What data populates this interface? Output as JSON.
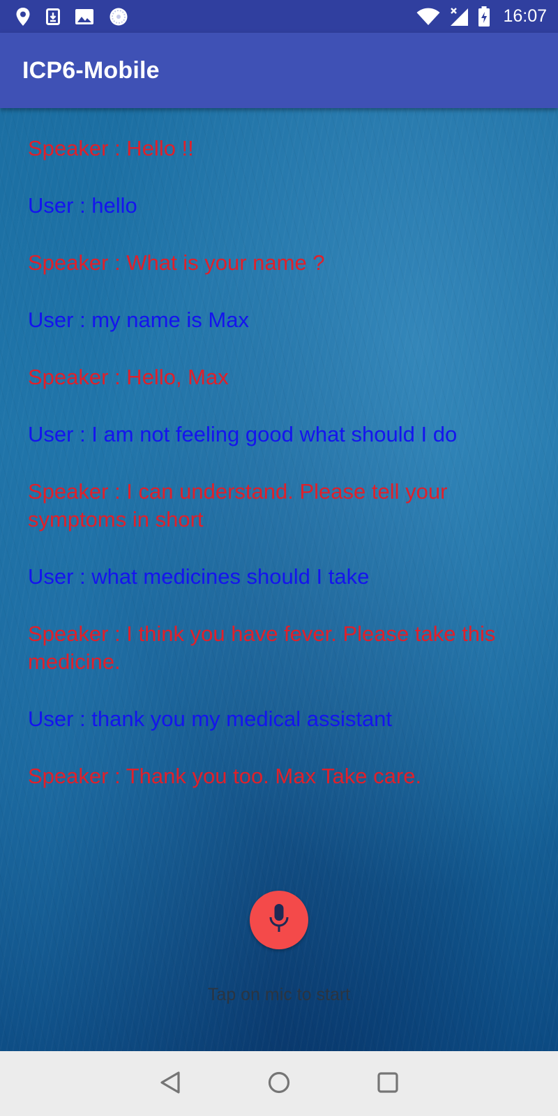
{
  "status_bar": {
    "time": "16:07",
    "icons": [
      "location-icon",
      "download-icon",
      "image-icon",
      "sync-icon",
      "wifi-icon",
      "signal-icon",
      "battery-charging-icon"
    ]
  },
  "app_bar": {
    "title": "ICP6-Mobile",
    "color": "#3f51b5"
  },
  "conversation": [
    {
      "role": "speaker",
      "text": "Speaker : Hello !!"
    },
    {
      "role": "user",
      "text": "User : hello"
    },
    {
      "role": "speaker",
      "text": "Speaker : What is your name ?"
    },
    {
      "role": "user",
      "text": "User : my name is Max"
    },
    {
      "role": "speaker",
      "text": "Speaker : Hello, Max"
    },
    {
      "role": "user",
      "text": "User : I am not feeling good what should I do"
    },
    {
      "role": "speaker",
      "text": "Speaker : I can understand. Please tell your symptoms in short"
    },
    {
      "role": "user",
      "text": "User : what medicines should I take"
    },
    {
      "role": "speaker",
      "text": "Speaker : I think you have fever. Please take this medicine."
    },
    {
      "role": "user",
      "text": "User : thank you my medical assistant"
    },
    {
      "role": "speaker",
      "text": "Speaker : Thank you too. Max Take care."
    }
  ],
  "colors": {
    "speaker_text": "#e0202a",
    "user_text": "#1414ee",
    "mic_button": "#f44a4a"
  },
  "mic": {
    "icon": "microphone-icon",
    "hint": "Tap on mic to start"
  },
  "nav_bar": {
    "icons": [
      "back-icon",
      "home-icon",
      "recents-icon"
    ]
  }
}
